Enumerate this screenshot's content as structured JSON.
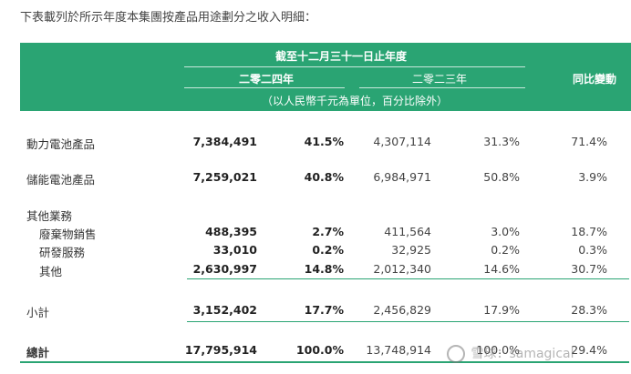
{
  "intro": "下表載列於所示年度本集團按產品用途劃分之收入明細：",
  "header": {
    "period": "截至十二月三十一日止年度",
    "year_2024": "二零二四年",
    "year_2023": "二零二三年",
    "yoy": "同比變動",
    "unit": "（以人民幣千元為單位，百分比除外）"
  },
  "rows": {
    "power_battery": {
      "label": "動力電池產品",
      "v2024": "7,384,491",
      "p2024": "41.5%",
      "v2023": "4,307,114",
      "p2023": "31.3%",
      "yoy": "71.4%"
    },
    "storage_battery": {
      "label": "儲能電池產品",
      "v2024": "7,259,021",
      "p2024": "40.8%",
      "v2023": "6,984,971",
      "p2023": "50.8%",
      "yoy": "3.9%"
    },
    "other_business": {
      "label": "其他業務"
    },
    "scrap_sales": {
      "label": "廢棄物銷售",
      "v2024": "488,395",
      "p2024": "2.7%",
      "v2023": "411,564",
      "p2023": "3.0%",
      "yoy": "18.7%"
    },
    "rnd_services": {
      "label": "研發服務",
      "v2024": "33,010",
      "p2024": "0.2%",
      "v2023": "32,925",
      "p2023": "0.2%",
      "yoy": "0.3%"
    },
    "others": {
      "label": "其他",
      "v2024": "2,630,997",
      "p2024": "14.8%",
      "v2023": "2,012,340",
      "p2023": "14.6%",
      "yoy": "30.7%"
    },
    "subtotal": {
      "label": "小計",
      "v2024": "3,152,402",
      "p2024": "17.7%",
      "v2023": "2,456,829",
      "p2023": "17.9%",
      "yoy": "28.3%"
    },
    "total": {
      "label": "總計",
      "v2024": "17,795,914",
      "p2024": "100.0%",
      "v2023": "13,748,914",
      "p2023": "100.0%",
      "yoy": "29.4%"
    }
  },
  "watermark": "雪球：samagical",
  "colors": {
    "header_bg": "#2aa473",
    "rule": "#2aa473"
  }
}
